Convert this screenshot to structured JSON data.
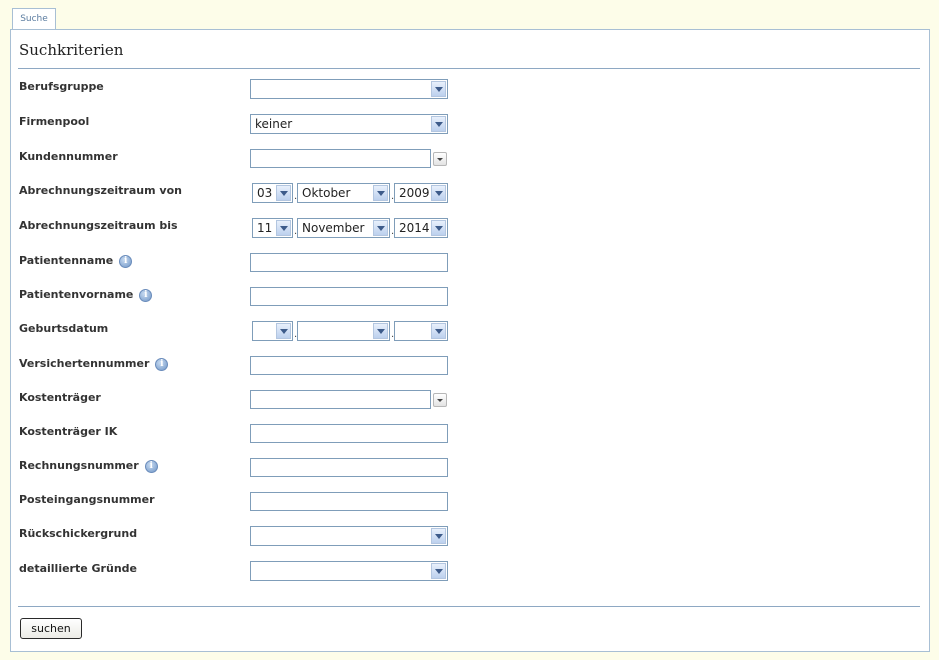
{
  "tab": {
    "label": "Suche"
  },
  "panel": {
    "title": "Suchkriterien"
  },
  "fields": {
    "berufsgruppe": {
      "label": "Berufsgruppe",
      "value": ""
    },
    "firmenpool": {
      "label": "Firmenpool",
      "value": "keiner"
    },
    "kundennummer": {
      "label": "Kundennummer",
      "value": ""
    },
    "zeitraum_von": {
      "label": "Abrechnungszeitraum von",
      "day": "03",
      "month": "Oktober",
      "year": "2009"
    },
    "zeitraum_bis": {
      "label": "Abrechnungszeitraum bis",
      "day": "11",
      "month": "November",
      "year": "2014"
    },
    "patientenname": {
      "label": "Patientenname",
      "value": ""
    },
    "patientenvorname": {
      "label": "Patientenvorname",
      "value": ""
    },
    "geburtsdatum": {
      "label": "Geburtsdatum",
      "day": "",
      "month": "",
      "year": ""
    },
    "versichertennummer": {
      "label": "Versichertennummer",
      "value": ""
    },
    "kostentraeger": {
      "label": "Kostenträger",
      "value": ""
    },
    "kostentraeger_ik": {
      "label": "Kostenträger IK",
      "value": ""
    },
    "rechnungsnummer": {
      "label": "Rechnungsnummer",
      "value": ""
    },
    "posteingangsnummer": {
      "label": "Posteingangsnummer",
      "value": ""
    },
    "rueckschickergrund": {
      "label": "Rückschickergrund",
      "value": ""
    },
    "detaillierte_gruende": {
      "label": "detaillierte Gründe",
      "value": ""
    }
  },
  "info_icon_glyph": "i",
  "date_separator": ".",
  "actions": {
    "search_label": "suchen"
  }
}
